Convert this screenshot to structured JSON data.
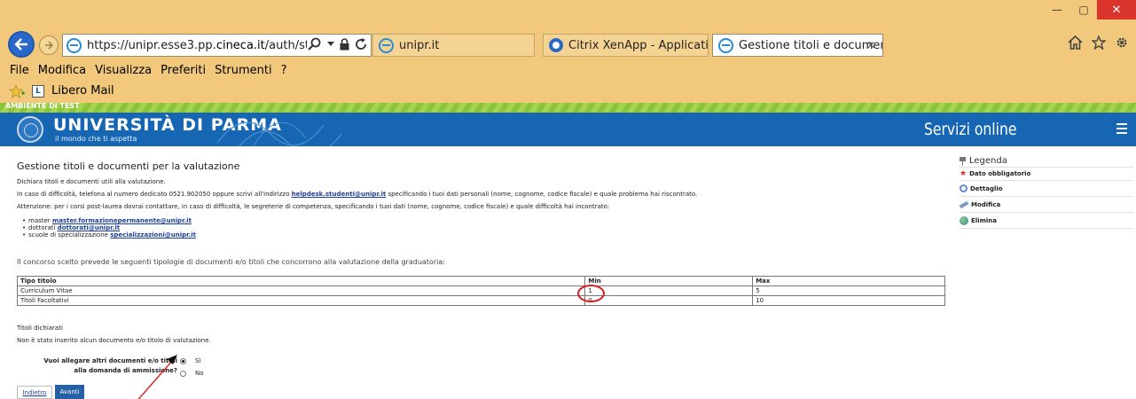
{
  "browser": {
    "window_buttons": {
      "minimize": "—",
      "maximize": "▢",
      "close": "✕"
    },
    "address_url_prefix": "https://unipr.esse3.pp.",
    "address_url_domain": "cineca.it",
    "address_url_suffix": "/auth/studente/A",
    "address_search_icon": "search-icon",
    "tabs": [
      {
        "label": "unipr.it",
        "icon": "ie-icon"
      },
      {
        "label": "Citrix XenApp - Applications",
        "icon": "citrix-icon"
      },
      {
        "label": "Gestione titoli e documenti ...",
        "icon": "ie-icon",
        "active": true
      }
    ],
    "tab_close": "✕",
    "menu": [
      "File",
      "Modifica",
      "Visualizza",
      "Preferiti",
      "Strumenti",
      "?"
    ],
    "favorites": [
      {
        "label": "Libero Mail"
      }
    ],
    "accent_color": "#f2c97c"
  },
  "site": {
    "test_banner": "AMBIENTE DI TEST",
    "university_name": "UNIVERSITÀ DI PARMA",
    "motto": "il mondo che ti aspetta",
    "services_title": "Servizi online",
    "header_color": "#1766b3"
  },
  "content": {
    "page_title": "Gestione titoli e documenti per la valutazione",
    "intro": "Dichiara titoli e documenti utili alla valutazione.",
    "help_line_before": "In caso di difficoltà, telefona al numero dedicato 0521.902050 oppure scrivi all'indirizzo",
    "help_email": "helpdesk.studenti@unipr.it",
    "help_line_after": "specificando i tuoi dati personali (nome, cognome, codice fiscale) e quale problema hai riscontrato.",
    "postgrad_line": "Attenzione: per i corsi post-laurea dovrai contattare, in caso di difficoltà, le segreterie di competenza, specificando i tuoi dati (nome, cognome, codice fiscale) e quale difficoltà hai incontrato:",
    "contacts": [
      {
        "label": "master",
        "email": "master.formazionepermanente@unipr.it"
      },
      {
        "label": "dottorati",
        "email": "dottorati@unipr.it"
      },
      {
        "label": "scuole di specializzazione",
        "email": "specializzazioni@unipr.it"
      }
    ],
    "contest_line": "Il concorso scelto prevede le seguenti tipologie di documenti e/o titoli che concorrono alla valutazione della graduatoria:",
    "table": {
      "headers": [
        "Tipo titolo",
        "Min",
        "Max"
      ],
      "rows": [
        [
          "Curriculum Vitae",
          "1",
          "5"
        ],
        [
          "Titoli Facoltativi",
          "0",
          "10"
        ]
      ]
    },
    "declared_title": "Titoli dichiarati",
    "declared_none": "Non è stato inserito alcun documento e/o titolo di valutazione.",
    "question": "Vuoi allegare altri documenti e/o titoli alla domanda di ammissione?",
    "options": [
      {
        "label": "Sì",
        "selected": true
      },
      {
        "label": "No",
        "selected": false
      }
    ],
    "back_label": "Indietro",
    "next_label": "Avanti",
    "annotation_color": "#d81f1f"
  },
  "legend": {
    "title": "Legenda",
    "items": [
      {
        "label": "Dato obbligatorio",
        "icon": "star-icon"
      },
      {
        "label": "Dettaglio",
        "icon": "magnifier-icon"
      },
      {
        "label": "Modifica",
        "icon": "pencil-icon"
      },
      {
        "label": "Elimina",
        "icon": "globe-icon"
      }
    ]
  }
}
